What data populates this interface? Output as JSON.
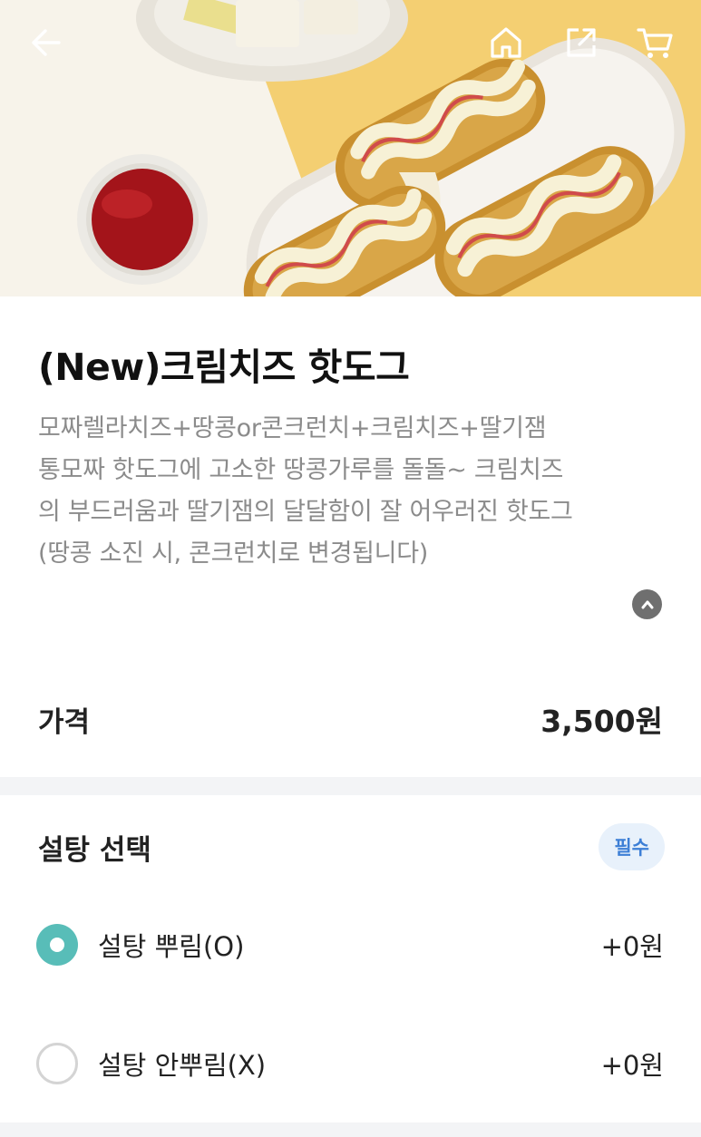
{
  "header": {
    "back_icon": "arrow-left-icon",
    "home_icon": "home-icon",
    "share_icon": "share-icon",
    "cart_icon": "cart-icon"
  },
  "product": {
    "title": "(New)크림치즈 핫도그",
    "description_lines": [
      "모짜렐라치즈+땅콩or콘크런치+크림치즈+딸기잼",
      "통모짜 핫도그에 고소한 땅콩가루를 돌돌~ 크림치즈",
      "의 부드러움과 딸기잼의 달달함이 잘 어우러진 핫도그",
      "(땅콩 소진 시, 콘크런치로 변경됩니다)"
    ],
    "collapse_icon": "chevron-up-icon"
  },
  "price": {
    "label": "가격",
    "value": "3,500원"
  },
  "option_group": {
    "title": "설탕 선택",
    "badge": "필수",
    "options": [
      {
        "label": "설탕 뿌림(O)",
        "price": "+0원",
        "selected": true
      },
      {
        "label": "설탕 안뿌림(X)",
        "price": "+0원",
        "selected": false
      }
    ]
  },
  "colors": {
    "accent": "#58bdb8",
    "badge_text": "#3d7fd6",
    "badge_bg": "#e8f1fb",
    "muted_text": "#8b8b8b",
    "section_divider": "#f3f4f6"
  }
}
